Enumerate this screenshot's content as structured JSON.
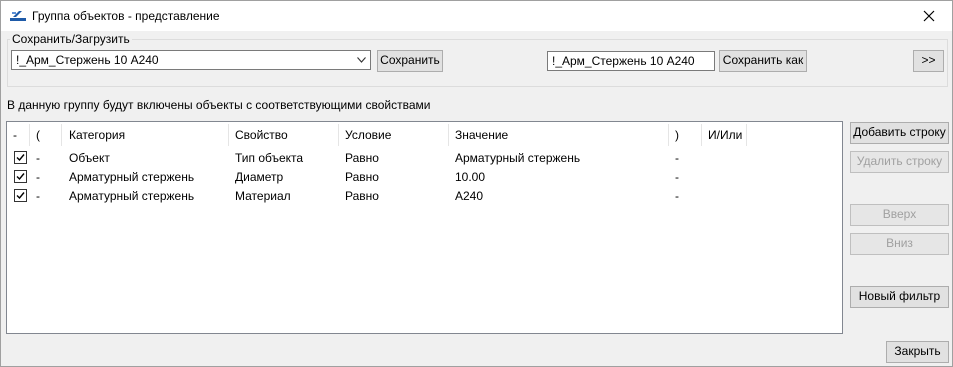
{
  "window": {
    "title": "Группа объектов - представление",
    "close_glyph": "✕"
  },
  "save_load": {
    "legend": "Сохранить/Загрузить",
    "preset_selected": "!_Арм_Стержень 10 А240",
    "save_label": "Сохранить",
    "save_as_name": "!_Арм_Стержень 10 А240",
    "save_as_label": "Сохранить как",
    "more_label": ">>"
  },
  "info_text": "В данную группу будут включены объекты с соответствующими свойствами",
  "table": {
    "headers": [
      "-",
      "(",
      "Категория",
      "Свойство",
      "Условие",
      "Значение",
      ")",
      "И/Или"
    ],
    "rows": [
      {
        "checked": true,
        "open": "-",
        "category": "Объект",
        "property": "Тип объекта",
        "condition": "Равно",
        "value": "Арматурный стержень",
        "close": "-",
        "andor": ""
      },
      {
        "checked": true,
        "open": "-",
        "category": "Арматурный стержень",
        "property": "Диаметр",
        "condition": "Равно",
        "value": "10.00",
        "close": "-",
        "andor": ""
      },
      {
        "checked": true,
        "open": "-",
        "category": "Арматурный стержень",
        "property": "Материал",
        "condition": "Равно",
        "value": "A240",
        "close": "-",
        "andor": ""
      }
    ]
  },
  "side_buttons": {
    "add_row": "Добавить строку",
    "delete_row": "Удалить строку",
    "up": "Вверх",
    "down": "Вниз",
    "new_filter": "Новый фильтр"
  },
  "close_label": "Закрыть",
  "colors": {
    "accent": "#1e5aa8"
  }
}
